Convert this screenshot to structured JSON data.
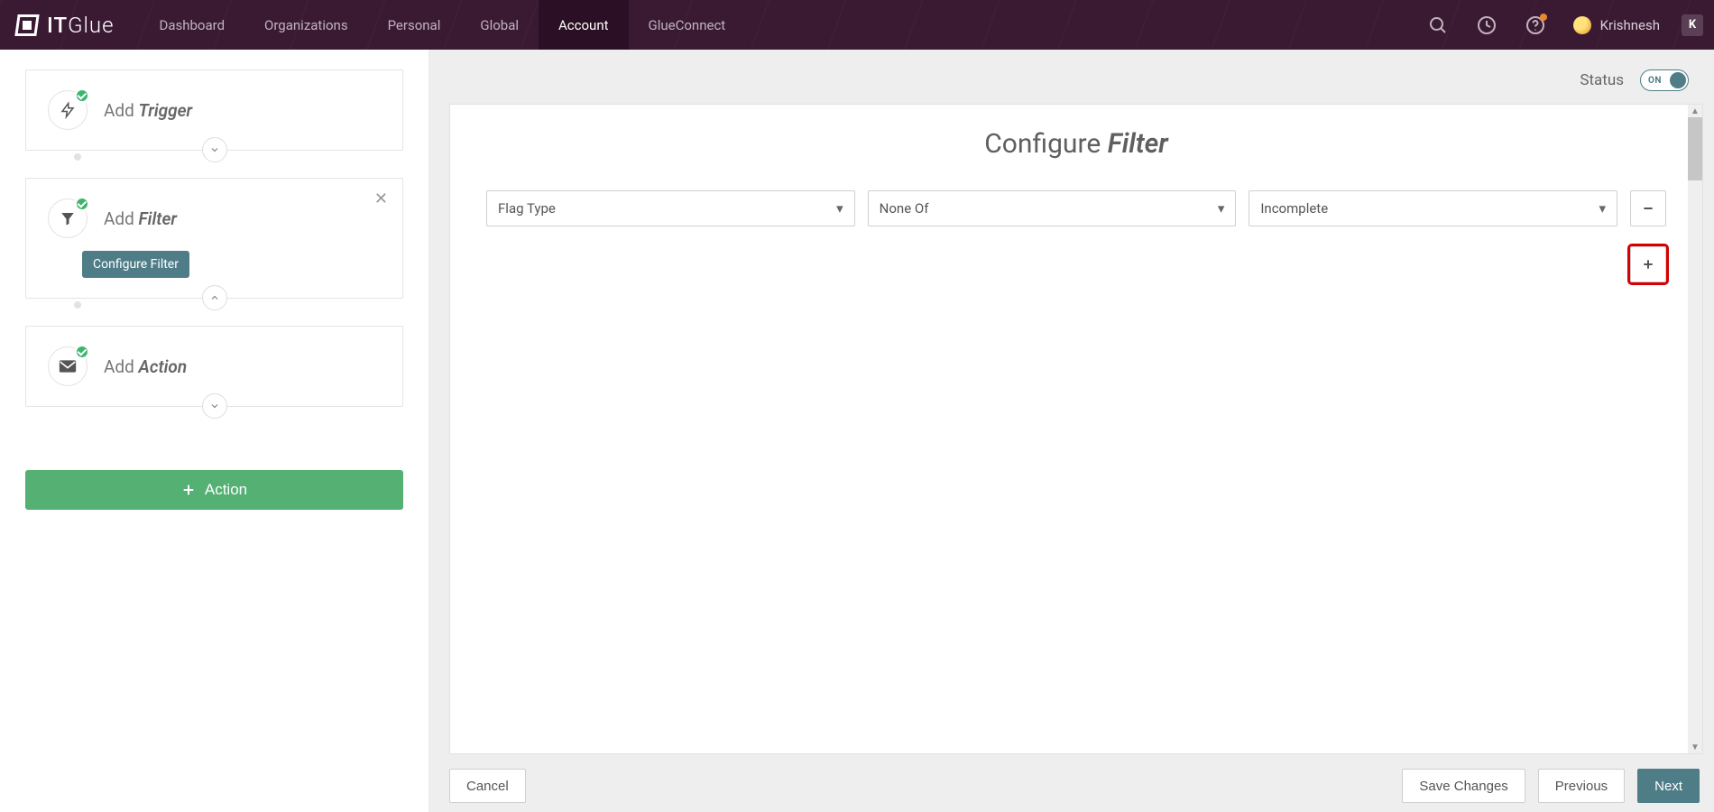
{
  "nav": {
    "logo_bold": "IT",
    "logo_thin": "Glue",
    "items": [
      {
        "label": "Dashboard"
      },
      {
        "label": "Organizations"
      },
      {
        "label": "Personal"
      },
      {
        "label": "Global"
      },
      {
        "label": "Account"
      },
      {
        "label": "GlueConnect"
      }
    ],
    "active_index": 4,
    "user_name": "Krishnesh",
    "badge": "K"
  },
  "sidebar": {
    "steps": [
      {
        "add": "Add",
        "kind": "Trigger"
      },
      {
        "add": "Add",
        "kind": "Filter",
        "sub_label": "Configure Filter",
        "closable": true
      },
      {
        "add": "Add",
        "kind": "Action"
      }
    ],
    "action_button": "Action"
  },
  "status": {
    "label": "Status",
    "toggle": "ON"
  },
  "panel": {
    "title_a": "Configure",
    "title_b": "Filter",
    "selects": [
      {
        "value": "Flag Type"
      },
      {
        "value": "None Of"
      },
      {
        "value": "Incomplete"
      }
    ]
  },
  "footer": {
    "cancel": "Cancel",
    "save": "Save Changes",
    "previous": "Previous",
    "next": "Next"
  }
}
